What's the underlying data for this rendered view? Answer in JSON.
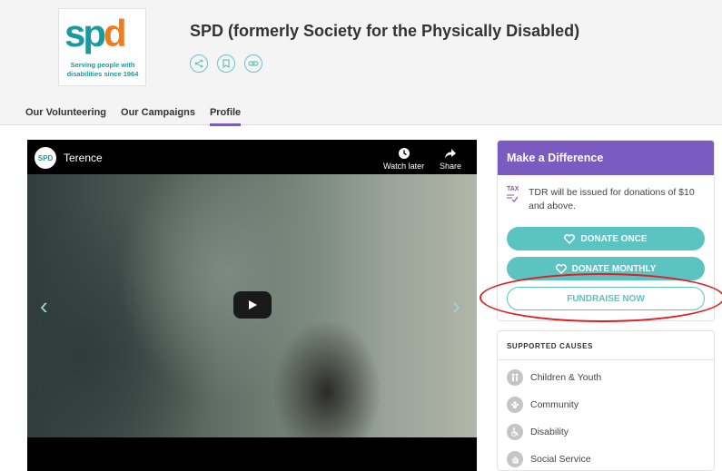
{
  "org": {
    "logo_text": "spd",
    "logo_tagline": "Serving people with disabilities since 1964",
    "title": "SPD (formerly Society for the Physically Disabled)",
    "share_icons": [
      "share-icon",
      "bookmark-icon",
      "link-icon"
    ]
  },
  "tabs": [
    {
      "label": "Our Volunteering",
      "active": false
    },
    {
      "label": "Our Campaigns",
      "active": false
    },
    {
      "label": "Profile",
      "active": true
    }
  ],
  "video": {
    "channel_avatar": "SPD",
    "title": "Terence",
    "watch_later": "Watch later",
    "share": "Share"
  },
  "donate_panel": {
    "heading": "Make a Difference",
    "tdr_badge": "TAX",
    "tdr_text": "TDR will be issued for donations of $10 and above.",
    "donate_once": "DONATE ONCE",
    "donate_monthly": "DONATE MONTHLY",
    "fundraise": "FUNDRAISE NOW"
  },
  "causes": {
    "heading": "SUPPORTED CAUSES",
    "items": [
      {
        "label": "Children & Youth",
        "icon": "children-icon"
      },
      {
        "label": "Community",
        "icon": "community-icon"
      },
      {
        "label": "Disability",
        "icon": "wheelchair-icon"
      },
      {
        "label": "Social Service",
        "icon": "hand-icon"
      }
    ]
  },
  "colors": {
    "accent_purple": "#7a5bbf",
    "teal": "#5cc3c3",
    "annotation_red": "#e02020"
  }
}
